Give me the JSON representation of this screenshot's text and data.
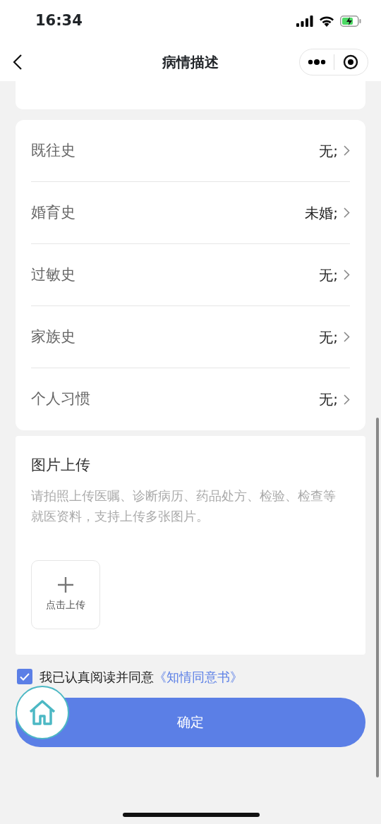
{
  "status_bar": {
    "time": "16:34"
  },
  "nav": {
    "title": "病情描述"
  },
  "history": [
    {
      "label": "既往史",
      "value": "无;"
    },
    {
      "label": "婚育史",
      "value": "未婚;"
    },
    {
      "label": "过敏史",
      "value": "无;"
    },
    {
      "label": "家族史",
      "value": "无;"
    },
    {
      "label": "个人习惯",
      "value": "无;"
    }
  ],
  "upload": {
    "title": "图片上传",
    "hint": "请拍照上传医嘱、诊断病历、药品处方、检验、检查等就医资料，支持上传多张图片。",
    "button_label": "点击上传"
  },
  "agreement": {
    "checked": true,
    "text": "我已认真阅读并同意",
    "link": "《知情同意书》"
  },
  "confirm_button": "确定"
}
